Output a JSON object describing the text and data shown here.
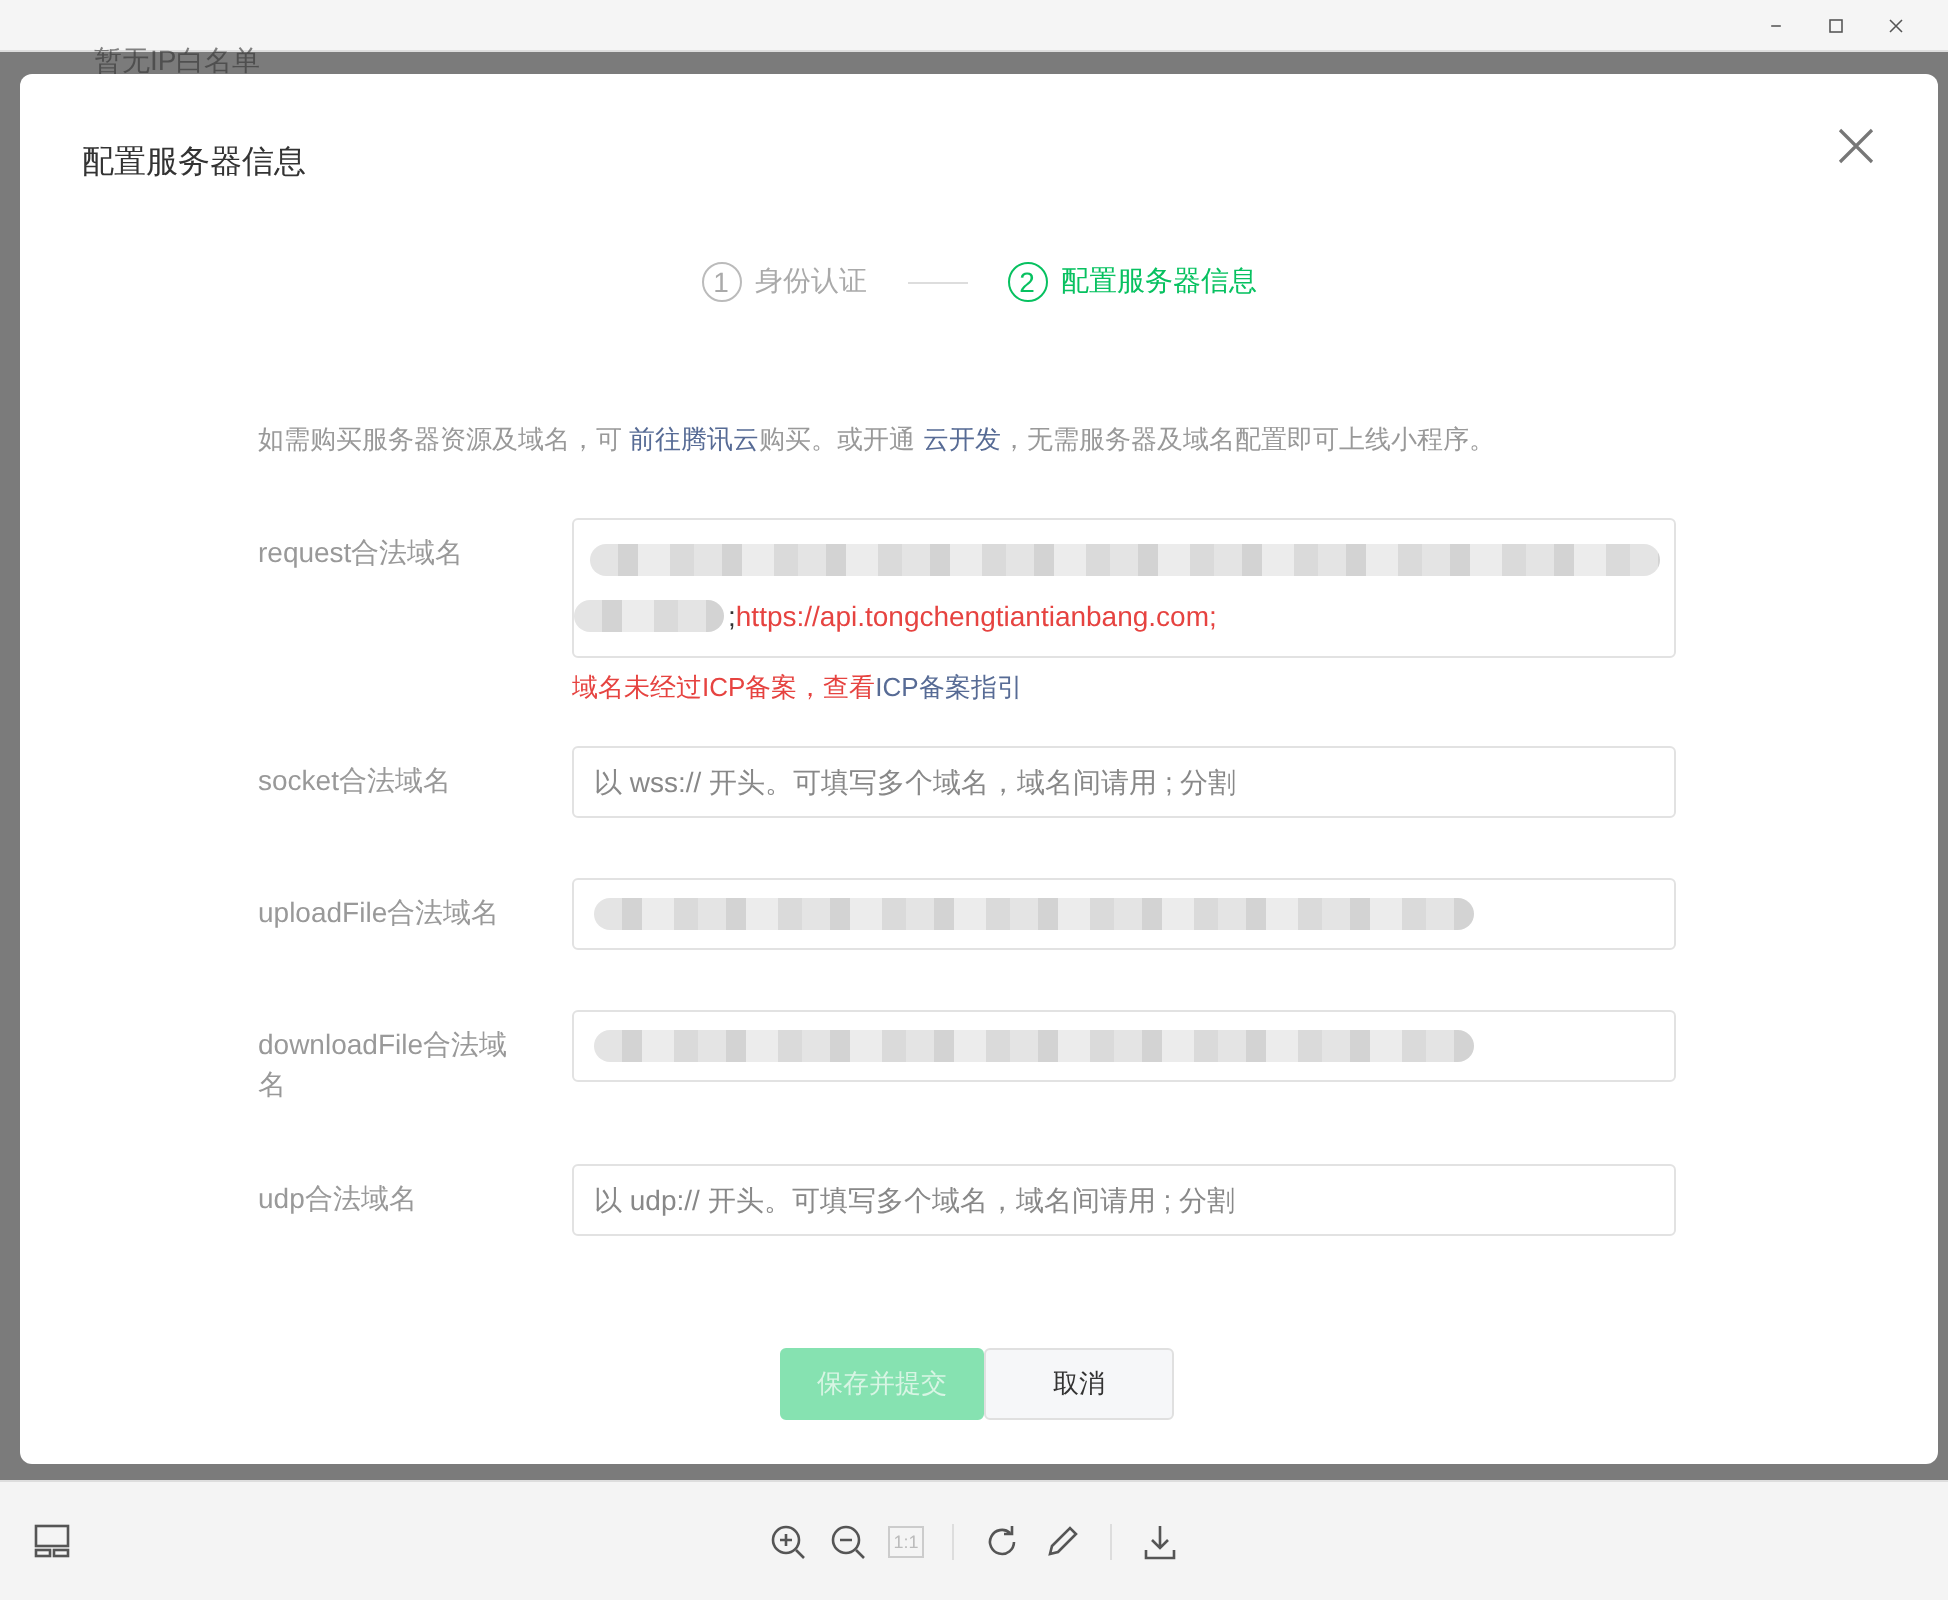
{
  "background_text": "暂无IP白名单",
  "dialog": {
    "title": "配置服务器信息",
    "steps": [
      {
        "number": "1",
        "label": "身份认证",
        "selected": false
      },
      {
        "number": "2",
        "label": "配置服务器信息",
        "selected": true
      }
    ],
    "notice": [
      {
        "kind": "text",
        "text": "如需购买服务器资源及域名，可 "
      },
      {
        "kind": "link",
        "text": "前往腾讯云"
      },
      {
        "kind": "text",
        "text": "购买。或开通 "
      },
      {
        "kind": "link",
        "text": "云开发"
      },
      {
        "kind": "text",
        "text": "，无需服务器及域名配置即可上线小程序。"
      }
    ],
    "fields": [
      {
        "label": "request合法域名",
        "kind": "textarea",
        "redacted": true,
        "value_tail": ";",
        "invalid_value": "https://api.tongchengtiantianbang.com;",
        "error": "域名未经过ICP备案，查看",
        "error_link": "ICP备案指引"
      },
      {
        "label": "socket合法域名",
        "kind": "input",
        "redacted": false,
        "placeholder": "以 wss:// 开头。可填写多个域名，域名间请用 ; 分割"
      },
      {
        "label": "uploadFile合法域名",
        "kind": "input",
        "redacted": true
      },
      {
        "label": "downloadFile合法域名",
        "kind": "input",
        "redacted": true
      },
      {
        "label": "udp合法域名",
        "kind": "input",
        "redacted": false,
        "placeholder": "以 udp:// 开头。可填写多个域名，域名间请用 ; 分割"
      }
    ],
    "buttons": [
      {
        "label": "保存并提交",
        "kind": "primary",
        "disabled": true
      },
      {
        "label": "取消",
        "kind": "secondary",
        "disabled": false
      }
    ]
  },
  "toolbar": {
    "actual_size": "1:1"
  }
}
